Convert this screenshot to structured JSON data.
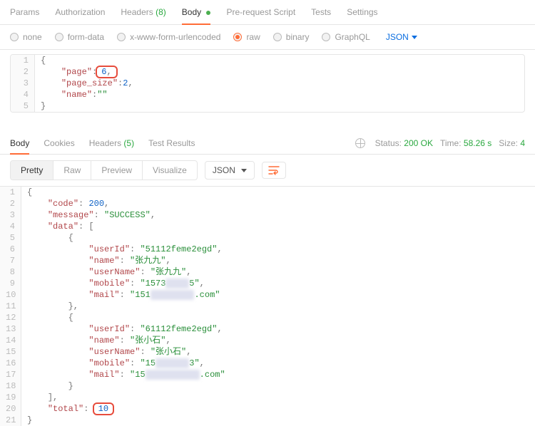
{
  "tabs": {
    "params": "Params",
    "authorization": "Authorization",
    "headers": "Headers",
    "headers_count": "(8)",
    "body": "Body",
    "prerequest": "Pre-request Script",
    "tests": "Tests",
    "settings": "Settings"
  },
  "body_types": {
    "none": "none",
    "form_data": "form-data",
    "urlencoded": "x-www-form-urlencoded",
    "raw": "raw",
    "binary": "binary",
    "graphql": "GraphQL",
    "content_type": "JSON"
  },
  "request_body": {
    "lines": [
      "1",
      "2",
      "3",
      "4",
      "5"
    ],
    "page_key": "\"page\"",
    "page_val": "6",
    "page_size_key": "\"page_size\"",
    "page_size_val": "2",
    "name_key": "\"name\"",
    "name_val": "\"\""
  },
  "response_tabs": {
    "body": "Body",
    "cookies": "Cookies",
    "headers": "Headers",
    "headers_count": "(5)",
    "test_results": "Test Results"
  },
  "status": {
    "status_label": "Status:",
    "status_value": "200 OK",
    "time_label": "Time:",
    "time_value": "58.26 s",
    "size_label": "Size:",
    "size_value": "4"
  },
  "view_modes": {
    "pretty": "Pretty",
    "raw": "Raw",
    "preview": "Preview",
    "visualize": "Visualize",
    "format": "JSON"
  },
  "response_body": {
    "nums": [
      "1",
      "2",
      "3",
      "4",
      "5",
      "6",
      "7",
      "8",
      "9",
      "10",
      "11",
      "12",
      "13",
      "14",
      "15",
      "16",
      "17",
      "18",
      "19",
      "20",
      "21"
    ],
    "code_key": "\"code\"",
    "code_val": "200",
    "message_key": "\"message\"",
    "message_val": "\"SUCCESS\"",
    "data_key": "\"data\"",
    "userId_key": "\"userId\"",
    "name_key": "\"name\"",
    "userName_key": "\"userName\"",
    "mobile_key": "\"mobile\"",
    "mail_key": "\"mail\"",
    "u1_userId": "\"51112feme2egd\"",
    "u1_name": "\"张九九\"",
    "u1_userName": "\"张九九\"",
    "u1_mobile_a": "\"1573",
    "u1_mobile_b": "5\"",
    "u1_mail_a": "\"151",
    "u1_mail_b": ".com\"",
    "u2_userId": "\"61112feme2egd\"",
    "u2_name": "\"张小石\"",
    "u2_userName": "\"张小石\"",
    "u2_mobile_a": "\"15",
    "u2_mobile_b": "3\"",
    "u2_mail_a": "\"15",
    "u2_mail_b": ".com\"",
    "total_key": "\"total\"",
    "total_val": "10"
  }
}
